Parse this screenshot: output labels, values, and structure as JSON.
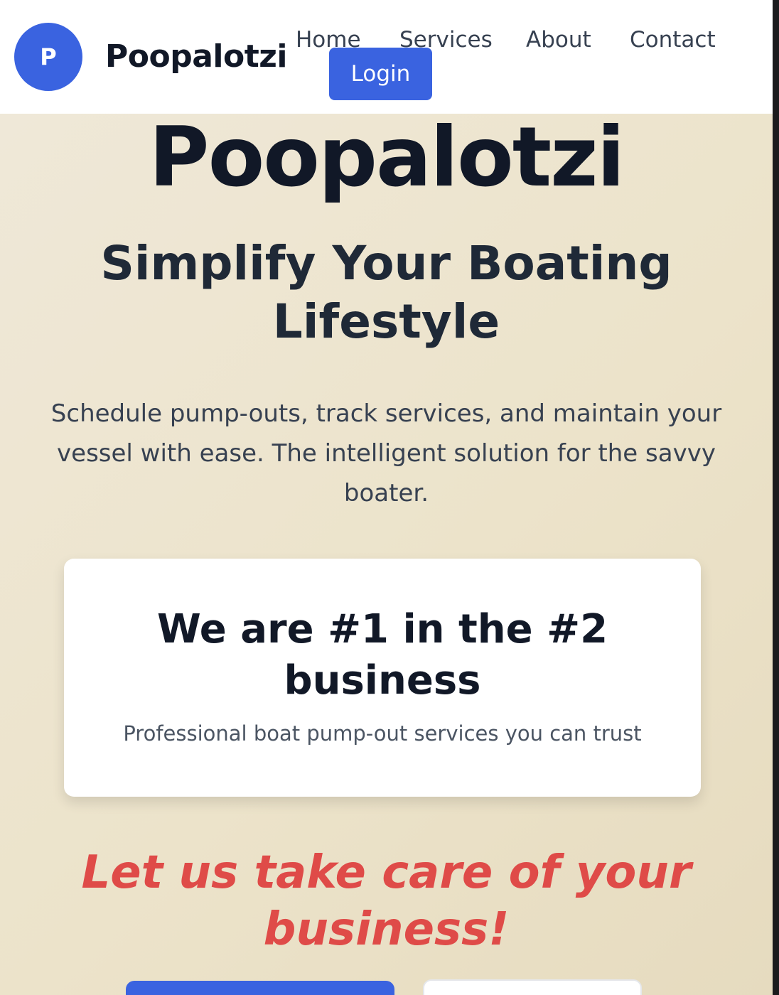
{
  "brand": {
    "logo_letter": "P",
    "name": "Poopalotzi"
  },
  "nav": {
    "items": [
      {
        "label": "Home"
      },
      {
        "label": "Services"
      },
      {
        "label": "About"
      },
      {
        "label": "Contact"
      }
    ],
    "login_label": "Login"
  },
  "hero": {
    "title": "Poopalotzi",
    "subtitle": "Simplify Your Boating Lifestyle",
    "description": "Schedule pump-outs, track services, and maintain your vessel with ease. The intelligent solution for the savvy boater."
  },
  "card": {
    "title": "We are #1 in the #2 business",
    "text": "Professional boat pump-out services you can trust"
  },
  "tagline": "Let us take care of your business!",
  "colors": {
    "accent": "#3a63e0",
    "tagline": "#df4b48",
    "hero_background": "#ece3ca"
  }
}
